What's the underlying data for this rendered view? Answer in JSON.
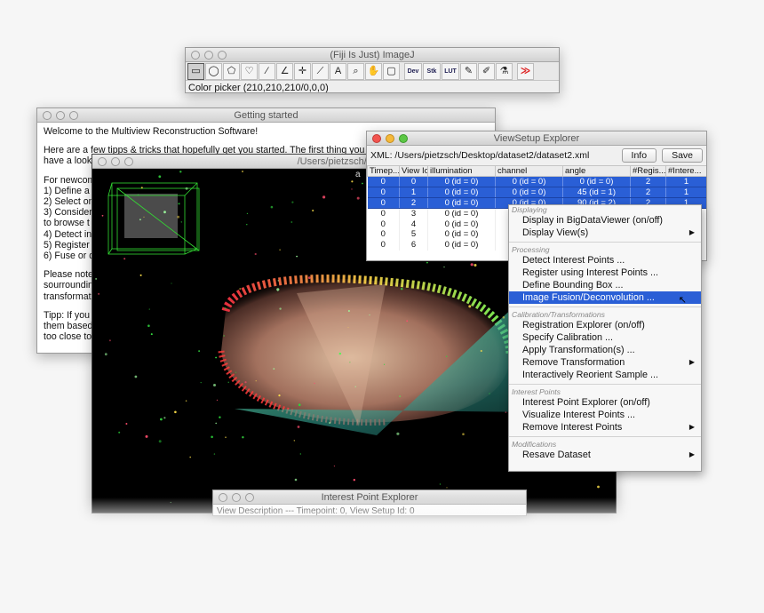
{
  "imagej": {
    "title": "(Fiji Is Just) ImageJ",
    "status": "Color picker (210,210,210/0,0,0)",
    "tools": [
      {
        "glyph": "▭",
        "icon": "rectangle-tool-icon"
      },
      {
        "glyph": "◯",
        "icon": "oval-tool-icon"
      },
      {
        "glyph": "⬠",
        "icon": "polygon-tool-icon"
      },
      {
        "glyph": "♡",
        "icon": "freehand-tool-icon"
      },
      {
        "glyph": "∕",
        "icon": "line-tool-icon"
      },
      {
        "glyph": "∠",
        "icon": "angle-tool-icon"
      },
      {
        "glyph": "✛",
        "icon": "point-tool-icon"
      },
      {
        "glyph": "⟋",
        "icon": "wand-tool-icon"
      },
      {
        "glyph": "A",
        "icon": "text-tool-icon"
      },
      {
        "glyph": "⌕",
        "icon": "magnifier-tool-icon"
      },
      {
        "glyph": "✋",
        "icon": "hand-tool-icon"
      },
      {
        "glyph": "▢",
        "icon": "color-picker-tool-icon"
      }
    ],
    "tools2": [
      {
        "label": "Dev",
        "icon": "dev-menu-icon"
      },
      {
        "label": "Stk",
        "icon": "stack-menu-icon"
      },
      {
        "label": "LUT",
        "icon": "lut-menu-icon"
      },
      {
        "glyph": "✎",
        "icon": "pencil-tool-icon"
      },
      {
        "glyph": "✐",
        "icon": "brush-tool-icon"
      },
      {
        "glyph": "⚗",
        "icon": "flood-fill-tool-icon"
      },
      {
        "glyph": "≫",
        "icon": "more-tools-icon"
      }
    ]
  },
  "getting_started": {
    "title": "Getting started",
    "welcome": "Welcome to the Multiview Reconstruction Software!",
    "tips_line1": "Here are a few tipps & tricks that hopefully get you started. The first thing you",
    "tips_line2": "have a look",
    "newcomers": [
      "For newcom",
      "1) Define a",
      "2) Select on",
      "3) Consider",
      "to browse t",
      "4) Detect in",
      "5) Register",
      "6) Fuse or d"
    ],
    "note": [
      "Please note",
      "sourroundin",
      "transformat"
    ],
    "tipp": [
      "Tipp: If you",
      "them based",
      "too close to"
    ]
  },
  "viewer": {
    "title": "/Users/pietzsch/Desktop/d",
    "overlay": "a"
  },
  "vse": {
    "title": "ViewSetup Explorer",
    "xml": "XML: /Users/pietzsch/Desktop/dataset2/dataset2.xml",
    "info_label": "Info",
    "save_label": "Save",
    "columns": [
      "Timep...",
      "View Id",
      "illumination",
      "channel",
      "angle",
      "#Regis...",
      "#Intere..."
    ],
    "rows": [
      {
        "selected": true,
        "cells": [
          "0",
          "0",
          "0 (id = 0)",
          "0 (id = 0)",
          "0 (id = 0)",
          "2",
          "1"
        ]
      },
      {
        "selected": true,
        "cells": [
          "0",
          "1",
          "0 (id = 0)",
          "0 (id = 0)",
          "45 (id = 1)",
          "2",
          "1"
        ]
      },
      {
        "selected": true,
        "cells": [
          "0",
          "2",
          "0 (id = 0)",
          "0 (id = 0)",
          "90 (id = 2)",
          "2",
          "1"
        ]
      },
      {
        "selected": false,
        "cells": [
          "0",
          "3",
          "0 (id = 0)",
          "",
          "",
          "",
          ""
        ]
      },
      {
        "selected": false,
        "cells": [
          "0",
          "4",
          "0 (id = 0)",
          "",
          "",
          "",
          ""
        ]
      },
      {
        "selected": false,
        "cells": [
          "0",
          "5",
          "0 (id = 0)",
          "",
          "",
          "",
          ""
        ]
      },
      {
        "selected": false,
        "cells": [
          "0",
          "6",
          "0 (id = 0)",
          "",
          "",
          "",
          ""
        ]
      }
    ]
  },
  "menu": {
    "sections": [
      {
        "header": "Displaying",
        "items": [
          {
            "label": "Display in BigDataViewer (on/off)",
            "submenu": false,
            "active": false
          },
          {
            "label": "Display View(s)",
            "submenu": true,
            "active": false
          }
        ]
      },
      {
        "header": "Processing",
        "items": [
          {
            "label": "Detect Interest Points ...",
            "submenu": false,
            "active": false
          },
          {
            "label": "Register using Interest Points ...",
            "submenu": false,
            "active": false
          },
          {
            "label": "Define Bounding Box ...",
            "submenu": false,
            "active": false
          },
          {
            "label": "Image Fusion/Deconvolution ...",
            "submenu": false,
            "active": true
          }
        ]
      },
      {
        "header": "Calibration/Transformations",
        "items": [
          {
            "label": "Registration Explorer (on/off)",
            "submenu": false,
            "active": false
          },
          {
            "label": "Specify Calibration ...",
            "submenu": false,
            "active": false
          },
          {
            "label": "Apply Transformation(s) ...",
            "submenu": false,
            "active": false
          },
          {
            "label": "Remove Transformation",
            "submenu": true,
            "active": false
          },
          {
            "label": "Interactively Reorient Sample ...",
            "submenu": false,
            "active": false
          }
        ]
      },
      {
        "header": "Interest Points",
        "items": [
          {
            "label": "Interest Point Explorer (on/off)",
            "submenu": false,
            "active": false
          },
          {
            "label": "Visualize Interest Points ...",
            "submenu": false,
            "active": false
          },
          {
            "label": "Remove Interest Points",
            "submenu": true,
            "active": false
          }
        ]
      },
      {
        "header": "Modifications",
        "items": [
          {
            "label": "Resave Dataset",
            "submenu": true,
            "active": false
          }
        ]
      }
    ],
    "submenu_arrow": "▶",
    "cursor_glyph": "↖"
  },
  "ipe": {
    "title": "Interest Point Explorer",
    "line": "View Description --- Timepoint: 0, View Setup Id: 0"
  },
  "colors": {
    "selection": "#2a5fd6",
    "viewer_bg": "#000000",
    "bbox_green": "#33dd33"
  }
}
